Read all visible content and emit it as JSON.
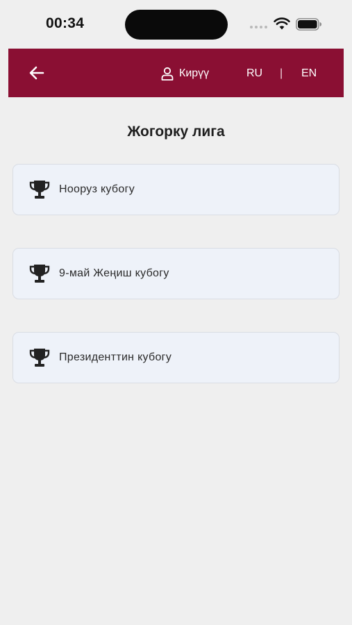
{
  "status_bar": {
    "time": "00:34",
    "icons": [
      "signal-dots-icon",
      "wifi-icon",
      "battery-icon"
    ]
  },
  "header": {
    "background_color": "#8a0f33",
    "back_icon": "arrow-left-icon",
    "login_icon": "user-icon",
    "login_label": "Кирүү",
    "lang_ru": "RU",
    "lang_separator": "|",
    "lang_en": "EN"
  },
  "page": {
    "title": "Жогорку лига"
  },
  "cups": [
    {
      "icon": "trophy-icon",
      "label": "Нооруз кубогу"
    },
    {
      "icon": "trophy-icon",
      "label": "9-май Жеңиш кубогу"
    },
    {
      "icon": "trophy-icon",
      "label": "Президенттин кубогу"
    }
  ]
}
